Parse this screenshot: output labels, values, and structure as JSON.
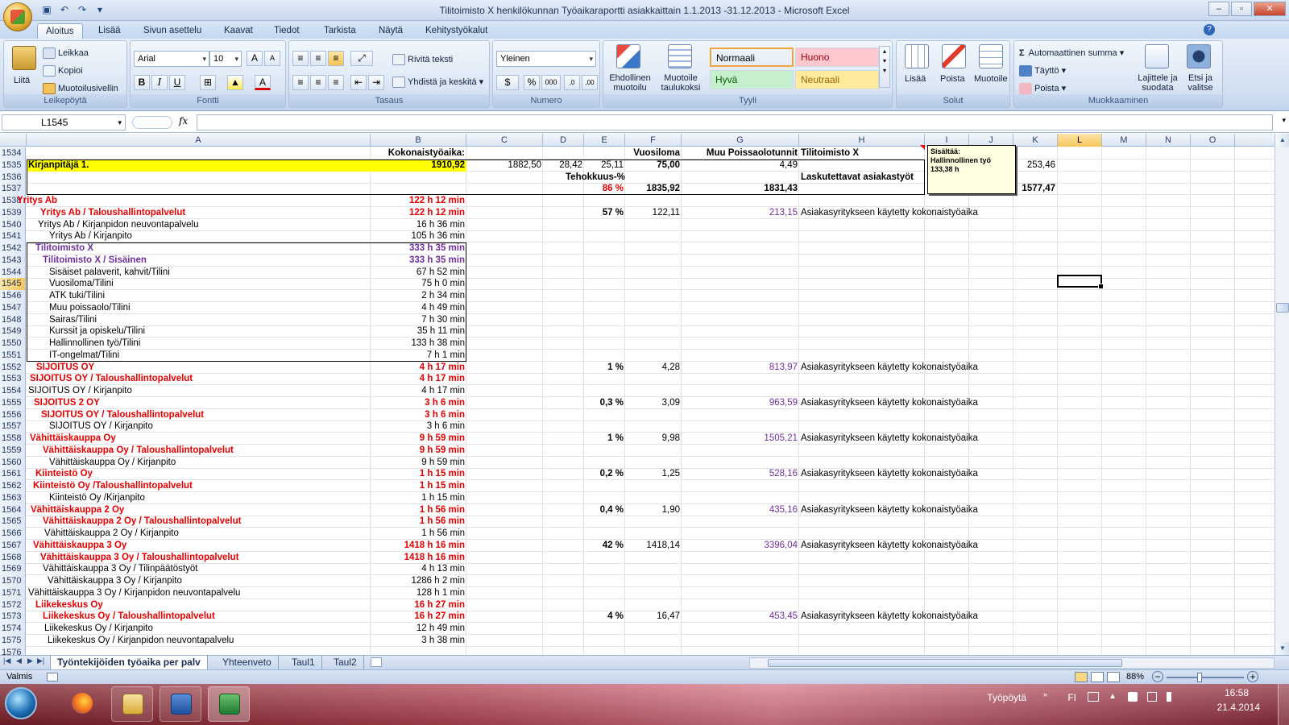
{
  "window": {
    "title": "Tilitoimisto X henkilökunnan Työaikaraportti asiakkaittain 1.1.2013 -31.12.2013 - Microsoft Excel"
  },
  "ribbon": {
    "tabs": [
      "Aloitus",
      "Lisää",
      "Sivun asettelu",
      "Kaavat",
      "Tiedot",
      "Tarkista",
      "Näytä",
      "Kehitystyökalut"
    ],
    "clipboard": {
      "paste": "Liitä",
      "cut": "Leikkaa",
      "copy": "Kopioi",
      "format_painter": "Muotoilusivellin",
      "label": "Leikepöytä"
    },
    "font": {
      "name": "Arial",
      "size": "10",
      "bold": "B",
      "italic": "I",
      "underline": "U",
      "label": "Fontti"
    },
    "alignment": {
      "wrap": "Rivitä teksti",
      "merge": "Yhdistä ja keskitä",
      "label": "Tasaus"
    },
    "number": {
      "format": "Yleinen",
      "percent": "%",
      "thousands": "000",
      "label": "Numero"
    },
    "styles": {
      "conditional": "Ehdollinen muotoilu",
      "table": "Muotoile taulukoksi",
      "normal": "Normaali",
      "bad": "Huono",
      "good": "Hyvä",
      "neutral": "Neutraali",
      "label": "Tyyli"
    },
    "cells": {
      "insert": "Lisää",
      "delete": "Poista",
      "format": "Muotoile",
      "label": "Solut"
    },
    "editing": {
      "autosum": "Automaattinen summa",
      "fill": "Täyttö",
      "clear": "Poista",
      "sort": "Lajittele ja suodata",
      "find": "Etsi ja valitse",
      "label": "Muokkaaminen"
    },
    "colors": {
      "normal": "#ffffff",
      "bad": "#ffc7ce",
      "good": "#c6efce",
      "neutral": "#ffeb9c",
      "bad_text": "#9c0006",
      "good_text": "#006100",
      "neutral_text": "#9c6500"
    }
  },
  "formula_bar": {
    "name_box": "L1545",
    "fx": "fx",
    "value": ""
  },
  "columns": [
    "A",
    "B",
    "C",
    "D",
    "E",
    "F",
    "G",
    "H",
    "I",
    "J",
    "K",
    "L",
    "M",
    "N",
    "O"
  ],
  "selected_column": "L",
  "selected_row": "1545",
  "comment": {
    "lines": [
      "Sisältää:",
      "Hallinnollinen työ",
      "133,38 h"
    ]
  },
  "rows": [
    {
      "n": "1534",
      "B": "Kokonaistyöaika:",
      "F": "Vuosiloma",
      "G": "Muu Poissaolotunnit",
      "H": "Tilitoimisto X"
    },
    {
      "n": "1535",
      "A": "Kirjanpitäjä 1.",
      "B": "1910,92",
      "C": "1882,50",
      "D": "28,42",
      "E": "25,11",
      "F": "75,00",
      "G": "4,49",
      "H": "253,46"
    },
    {
      "n": "1536",
      "E": "Tehokkuus-%",
      "H": "Laskutettavat asiakastyöt"
    },
    {
      "n": "1537",
      "E": "86 %",
      "F": "1835,92",
      "G": "1831,43",
      "H": "1577,47"
    },
    {
      "n": "1538",
      "A": "Yritys Ab",
      "B": "122 h 12 min"
    },
    {
      "n": "1539",
      "A": "Yritys Ab / Taloushallintopalvelut",
      "B": "122 h 12 min",
      "E": "57 %",
      "F": "122,11",
      "G": "213,15",
      "H": "Asiakasyritykseen käytetty kokonaistyöaika"
    },
    {
      "n": "1540",
      "A": "Yritys Ab / Kirjanpidon neuvontapalvelu",
      "B": "16 h 36 min"
    },
    {
      "n": "1541",
      "A": "Yritys Ab / Kirjanpito",
      "B": "105 h 36 min"
    },
    {
      "n": "1542",
      "A": "Tilitoimisto X",
      "B": "333 h 35 min"
    },
    {
      "n": "1543",
      "A": "Tilitoimisto X / Sisäinen",
      "B": "333 h 35 min"
    },
    {
      "n": "1544",
      "A": "Sisäiset palaverit, kahvit/Tilini",
      "B": "67 h 52 min"
    },
    {
      "n": "1545",
      "A": "Vuosiloma/Tilini",
      "B": "75 h 0 min"
    },
    {
      "n": "1546",
      "A": "ATK tuki/Tilini",
      "B": "2 h 34 min"
    },
    {
      "n": "1547",
      "A": "Muu poissaolo/Tilini",
      "B": "4 h 49 min"
    },
    {
      "n": "1548",
      "A": "Sairas/Tilini",
      "B": "7 h 30 min"
    },
    {
      "n": "1549",
      "A": "Kurssit ja opiskelu/Tilini",
      "B": "35 h 11 min"
    },
    {
      "n": "1550",
      "A": "Hallinnollinen työ/Tilini",
      "B": "133 h 38 min"
    },
    {
      "n": "1551",
      "A": "IT-ongelmat/Tilini",
      "B": "7 h 1 min"
    },
    {
      "n": "1552",
      "A": "SIJOITUS OY",
      "B": "4 h 17 min",
      "E": "1 %",
      "F": "4,28",
      "G": "813,97",
      "H": "Asiakasyritykseen käytetty kokonaistyöaika"
    },
    {
      "n": "1553",
      "A": "SIJOITUS OY / Taloushallintopalvelut",
      "B": "4 h 17 min"
    },
    {
      "n": "1554",
      "A": "SIJOITUS OY / Kirjanpito",
      "B": "4 h 17 min"
    },
    {
      "n": "1555",
      "A": "SIJOITUS 2 OY",
      "B": "3 h 6 min",
      "E": "0,3 %",
      "F": "3,09",
      "G": "963,59",
      "H": "Asiakasyritykseen käytetty kokonaistyöaika"
    },
    {
      "n": "1556",
      "A": "SIJOITUS OY / Taloushallintopalvelut",
      "B": "3 h 6 min"
    },
    {
      "n": "1557",
      "A": "SIJOITUS OY /  Kirjanpito",
      "B": "3 h 6 min"
    },
    {
      "n": "1558",
      "A": "Vähittäiskauppa Oy",
      "B": "9 h 59 min",
      "E": "1 %",
      "F": "9,98",
      "G": "1505,21",
      "H": "Asiakasyritykseen käytetty kokonaistyöaika"
    },
    {
      "n": "1559",
      "A": "Vähittäiskauppa Oy / Taloushallintopalvelut",
      "B": "9 h 59 min"
    },
    {
      "n": "1560",
      "A": "Vähittäiskauppa Oy / Kirjanpito",
      "B": "9 h 59 min"
    },
    {
      "n": "1561",
      "A": "Kiinteistö  Oy",
      "B": "1 h 15 min",
      "E": "0,2 %",
      "F": "1,25",
      "G": "528,16",
      "H": "Asiakasyritykseen käytetty kokonaistyöaika"
    },
    {
      "n": "1562",
      "A": "Kiinteistö Oy /Taloushallintopalvelut",
      "B": "1 h 15 min"
    },
    {
      "n": "1563",
      "A": "Kiinteistö Oy /Kirjanpito",
      "B": "1 h 15 min"
    },
    {
      "n": "1564",
      "A": "Vähittäiskauppa 2 Oy",
      "B": "1 h 56 min",
      "E": "0,4 %",
      "F": "1,90",
      "G": "435,16",
      "H": "Asiakasyritykseen käytetty kokonaistyöaika"
    },
    {
      "n": "1565",
      "A": "Vähittäiskauppa 2 Oy / Taloushallintopalvelut",
      "B": "1 h 56 min"
    },
    {
      "n": "1566",
      "A": "Vähittäiskauppa 2 Oy / Kirjanpito",
      "B": "1 h 56 min"
    },
    {
      "n": "1567",
      "A": "Vähittäiskauppa 3 Oy",
      "B": "1418 h 16 min",
      "E": "42 %",
      "F": "1418,14",
      "G": "3396,04",
      "H": "Asiakasyritykseen käytetty kokonaistyöaika"
    },
    {
      "n": "1568",
      "A": "Vähittäiskauppa 3 Oy / Taloushallintopalvelut",
      "B": "1418 h 16 min"
    },
    {
      "n": "1569",
      "A": "Vähittäiskauppa 3 Oy / Tilinpäätöstyöt",
      "B": "4 h 13 min"
    },
    {
      "n": "1570",
      "A": "Vähittäiskauppa 3 Oy / Kirjanpito",
      "B": "1286 h 2 min"
    },
    {
      "n": "1571",
      "A": "Vähittäiskauppa 3 Oy / Kirjanpidon neuvontapalvelu",
      "B": "128 h 1 min"
    },
    {
      "n": "1572",
      "A": "Liikekeskus Oy",
      "B": "16 h 27 min"
    },
    {
      "n": "1573",
      "A": "Liikekeskus Oy / Taloushallintopalvelut",
      "B": "16 h 27 min",
      "E": "4 %",
      "F": "16,47",
      "G": "453,45",
      "H": "Asiakasyritykseen käytetty kokonaistyöaika"
    },
    {
      "n": "1574",
      "A": "Liikekeskus Oy / Kirjanpito",
      "B": "12 h 49 min"
    },
    {
      "n": "1575",
      "A": "Liikekeskus Oy / Kirjanpidon neuvontapalvelu",
      "B": "3 h 38 min"
    },
    {
      "n": "1576"
    }
  ],
  "sheet_tabs": [
    "Työntekijöiden työaika per palv",
    "Yhteenveto",
    "Taul1",
    "Taul2"
  ],
  "status": {
    "mode": "Valmis",
    "zoom": "88%"
  },
  "taskbar": {
    "desktop": "Työpöytä",
    "lang": "FI",
    "time": "16:58",
    "date": "21.4.2014"
  }
}
